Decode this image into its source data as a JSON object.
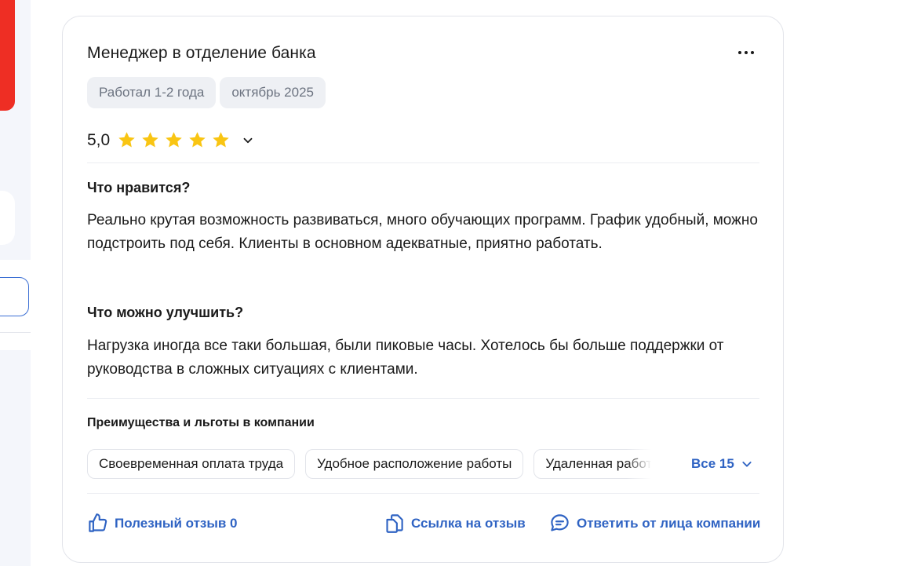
{
  "review": {
    "title": "Менеджер в отделение банка",
    "tags": [
      "Работал 1-2 года",
      "октябрь 2025"
    ],
    "rating": "5,0",
    "stars_filled": 5,
    "stars_total": 5,
    "pros_heading": "Что нравится?",
    "pros_text": "Реально крутая возможность развиваться, много обучающих программ. График удобный, можно подстроить под себя. Клиенты в основном адекватные, приятно работать.",
    "cons_heading": "Что можно улучшить?",
    "cons_text": "Нагрузка иногда все таки большая, были пиковые часы. Хотелось бы больше поддержки от руководства в сложных ситуациях с клиентами.",
    "benefits_heading": "Преимущества и льготы в компании",
    "benefits": [
      "Своевременная оплата труда",
      "Удобное расположение работы",
      "Удаленная работа"
    ],
    "all_benefits_label": "Все 15",
    "actions": {
      "useful": "Полезный отзыв 0",
      "link": "Ссылка на отзыв",
      "reply": "Ответить от лица компании"
    }
  },
  "icons": {
    "more": "more-horizontal-icon",
    "star": "star-icon",
    "chevron": "chevron-down-icon",
    "thumb": "thumbs-up-icon",
    "link": "copy-link-icon",
    "reply": "chat-bubble-icon"
  },
  "colors": {
    "accent": "#2f63c3",
    "star": "#f9c513",
    "brand_red": "#ee2e24",
    "tag_bg": "#eef0f4"
  }
}
